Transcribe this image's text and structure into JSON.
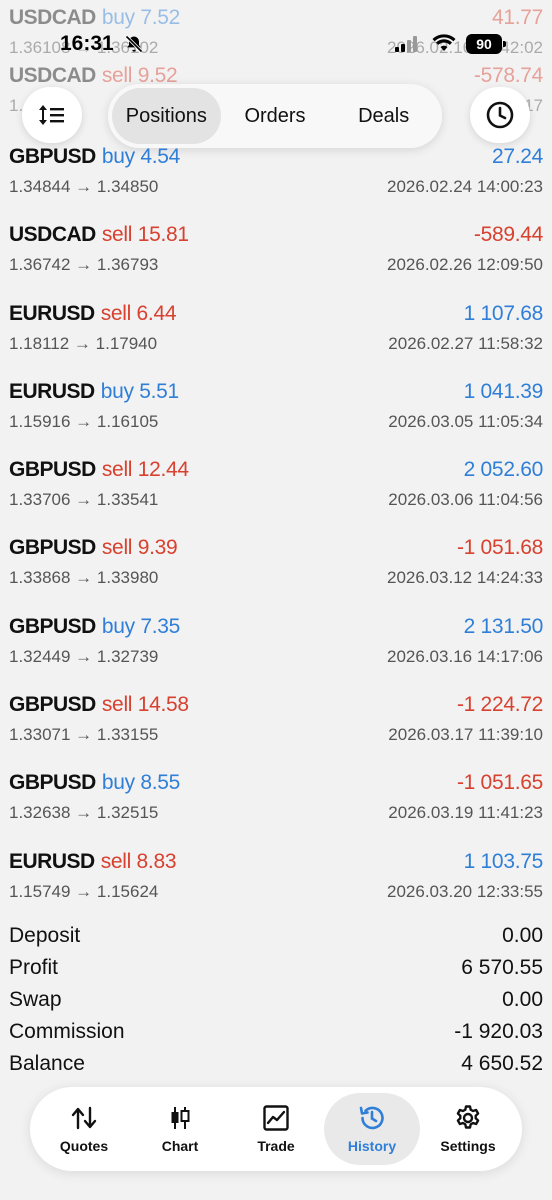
{
  "peek_rows": [
    {
      "symbol": "USDCAD",
      "side": "buy",
      "volume": "7.52",
      "amount": "41.77",
      "amount_sign": "neg",
      "prices": "1.36108 → 1.36102",
      "time": "2026.02.16 12:42:02"
    },
    {
      "symbol": "USDCAD",
      "side": "sell",
      "volume": "9.52",
      "amount": "-578.74",
      "amount_sign": "neg",
      "prices": "1.",
      "time": "17"
    }
  ],
  "status_bar": {
    "time": "16:31",
    "battery": "90"
  },
  "segmented": {
    "tabs": [
      {
        "label": "Positions",
        "active": true
      },
      {
        "label": "Orders",
        "active": false
      },
      {
        "label": "Deals",
        "active": false
      }
    ]
  },
  "deals": [
    {
      "symbol": "GBPUSD",
      "side": "buy",
      "volume": "4.54",
      "amount": "27.24",
      "amount_sign": "pos",
      "prices": "1.34844 → 1.34850",
      "time": "2026.02.24 14:00:23"
    },
    {
      "symbol": "USDCAD",
      "side": "sell",
      "volume": "15.81",
      "amount": "-589.44",
      "amount_sign": "neg",
      "prices": "1.36742 → 1.36793",
      "time": "2026.02.26 12:09:50"
    },
    {
      "symbol": "EURUSD",
      "side": "sell",
      "volume": "6.44",
      "amount": "1 107.68",
      "amount_sign": "pos",
      "prices": "1.18112 → 1.17940",
      "time": "2026.02.27 11:58:32"
    },
    {
      "symbol": "EURUSD",
      "side": "buy",
      "volume": "5.51",
      "amount": "1 041.39",
      "amount_sign": "pos",
      "prices": "1.15916 → 1.16105",
      "time": "2026.03.05 11:05:34"
    },
    {
      "symbol": "GBPUSD",
      "side": "sell",
      "volume": "12.44",
      "amount": "2 052.60",
      "amount_sign": "pos",
      "prices": "1.33706 → 1.33541",
      "time": "2026.03.06 11:04:56"
    },
    {
      "symbol": "GBPUSD",
      "side": "sell",
      "volume": "9.39",
      "amount": "-1 051.68",
      "amount_sign": "neg",
      "prices": "1.33868 → 1.33980",
      "time": "2026.03.12 14:24:33"
    },
    {
      "symbol": "GBPUSD",
      "side": "buy",
      "volume": "7.35",
      "amount": "2 131.50",
      "amount_sign": "pos",
      "prices": "1.32449 → 1.32739",
      "time": "2026.03.16 14:17:06"
    },
    {
      "symbol": "GBPUSD",
      "side": "sell",
      "volume": "14.58",
      "amount": "-1 224.72",
      "amount_sign": "neg",
      "prices": "1.33071 → 1.33155",
      "time": "2026.03.17 11:39:10"
    },
    {
      "symbol": "GBPUSD",
      "side": "buy",
      "volume": "8.55",
      "amount": "-1 051.65",
      "amount_sign": "neg",
      "prices": "1.32638 → 1.32515",
      "time": "2026.03.19 11:41:23"
    },
    {
      "symbol": "EURUSD",
      "side": "sell",
      "volume": "8.83",
      "amount": "1 103.75",
      "amount_sign": "pos",
      "prices": "1.15749 → 1.15624",
      "time": "2026.03.20 12:33:55"
    }
  ],
  "summary": [
    {
      "label": "Deposit",
      "value": "0.00"
    },
    {
      "label": "Profit",
      "value": "6 570.55"
    },
    {
      "label": "Swap",
      "value": "0.00"
    },
    {
      "label": "Commission",
      "value": "-1 920.03"
    },
    {
      "label": "Balance",
      "value": "4 650.52"
    }
  ],
  "tabbar": {
    "items": [
      {
        "label": "Quotes",
        "icon": "quotes-icon",
        "active": false
      },
      {
        "label": "Chart",
        "icon": "chart-icon",
        "active": false
      },
      {
        "label": "Trade",
        "icon": "trade-icon",
        "active": false
      },
      {
        "label": "History",
        "icon": "history-icon",
        "active": true
      },
      {
        "label": "Settings",
        "icon": "settings-icon",
        "active": false
      }
    ]
  },
  "colors": {
    "buy": "#2f7fd8",
    "sell": "#d8412f",
    "positive": "#2f7fd8",
    "negative": "#d8412f",
    "active_tab": "#2f7fd8"
  }
}
